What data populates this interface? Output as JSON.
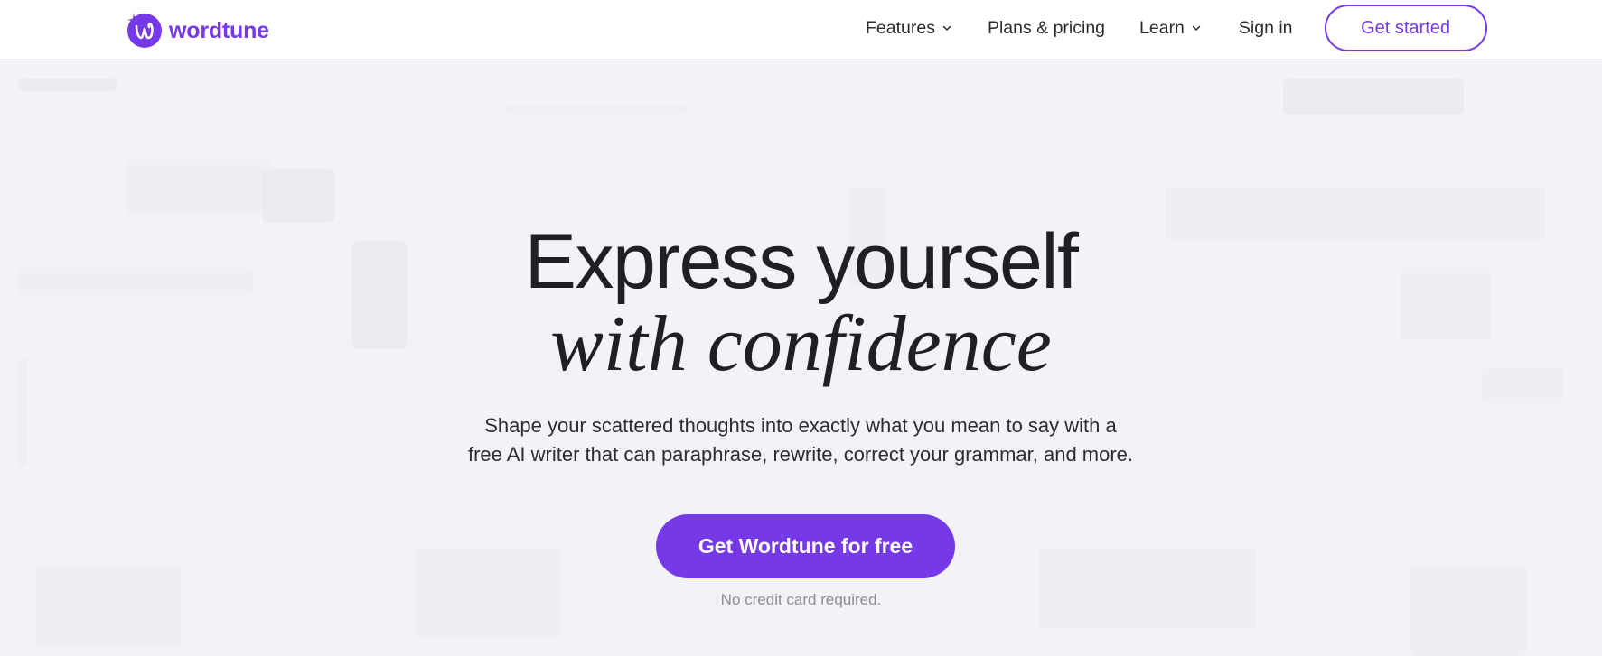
{
  "brand": {
    "name": "wordtune",
    "accent_color": "#7539e8",
    "logo_icon": "wordtune-logo-icon"
  },
  "nav": {
    "items": [
      {
        "label": "Features",
        "has_dropdown": true
      },
      {
        "label": "Plans & pricing",
        "has_dropdown": false
      },
      {
        "label": "Learn",
        "has_dropdown": true
      },
      {
        "label": "Sign in",
        "has_dropdown": false
      }
    ],
    "cta_label": "Get started"
  },
  "hero": {
    "headline_line1": "Express yourself",
    "headline_line2": "with confidence",
    "subtitle_line1": "Shape your scattered thoughts into exactly what you mean to say with a",
    "subtitle_line2": "free AI writer that can paraphrase, rewrite, correct your grammar, and more.",
    "cta_label": "Get Wordtune for free",
    "note": "No credit card required."
  }
}
